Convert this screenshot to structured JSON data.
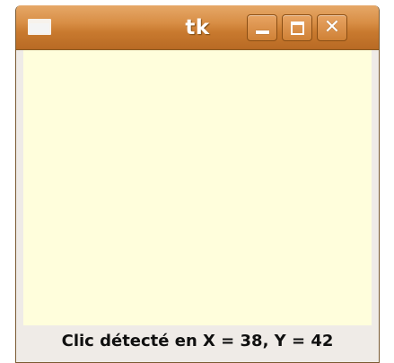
{
  "window": {
    "title": "tk"
  },
  "titlebar": {
    "buttons": {
      "minimize": "minimize-icon",
      "maximize": "maximize-icon",
      "close": "close-icon",
      "close_glyph": "✕"
    },
    "colors": {
      "accent": "#d88e45"
    }
  },
  "canvas": {
    "background": "#fffedc"
  },
  "status": {
    "text": "Clic détecté en X = 38, Y = 42"
  }
}
